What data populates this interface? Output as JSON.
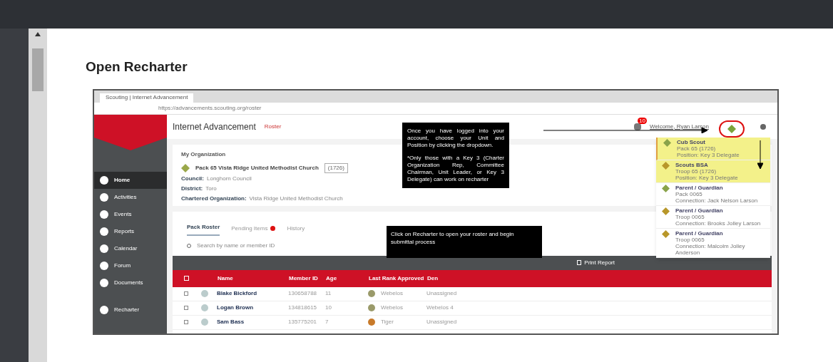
{
  "page_title": "Open Recharter",
  "browser": {
    "tab_title": "Scouting | Internet Advancement",
    "url": "https://advancements.scouting.org/roster"
  },
  "app": {
    "title": "Internet Advancement",
    "subtitle": "Roster",
    "notification_count": "10",
    "welcome": "Welcome, Ryan Larson"
  },
  "sidebar": [
    {
      "label": "Home",
      "selected": true
    },
    {
      "label": "Activities",
      "selected": false
    },
    {
      "label": "Events",
      "selected": false
    },
    {
      "label": "Reports",
      "selected": false
    },
    {
      "label": "Calendar",
      "selected": false
    },
    {
      "label": "Forum",
      "selected": false
    },
    {
      "label": "Documents",
      "selected": false
    },
    {
      "label": "Recharter",
      "selected": false
    }
  ],
  "organization": {
    "heading": "My Organization",
    "unit": "Pack 65 Vista Ridge United Methodist Church",
    "unit_id": "(1726)",
    "details": [
      {
        "label": "Council:",
        "value": "Longhorn Council"
      },
      {
        "label": "District:",
        "value": "Toro"
      },
      {
        "label": "Chartered Organization:",
        "value": "Vista Ridge United Methodist Church"
      }
    ]
  },
  "tabs": [
    {
      "label": "Pack Roster",
      "selected": true,
      "alert": false
    },
    {
      "label": "Pending Items",
      "selected": false,
      "alert": true
    },
    {
      "label": "History",
      "selected": false,
      "alert": false
    }
  ],
  "search": {
    "placeholder": "Search by name or member ID"
  },
  "toolbar": {
    "print_label": "Print Report"
  },
  "table": {
    "select_all_checked": false,
    "columns": [
      "Name",
      "Member ID",
      "Age",
      "Last Rank Approved",
      "Den"
    ],
    "rows": [
      {
        "checked": false,
        "name": "Blake Bickford",
        "member_id": "130658788",
        "age": "11",
        "rank": "Webelos",
        "color": "#9a9a6a",
        "den": "Unassigned"
      },
      {
        "checked": false,
        "name": "Logan Brown",
        "member_id": "134818615",
        "age": "10",
        "rank": "Webelos",
        "color": "#9a9a6a",
        "den": "Webelos 4"
      },
      {
        "checked": false,
        "name": "Sam Bass",
        "member_id": "135775201",
        "age": "7",
        "rank": "Tiger",
        "color": "#c87a2a",
        "den": "Unassigned"
      }
    ]
  },
  "callouts": [
    {
      "paragraphs": [
        "Once you have logged into your account, choose your Unit and Position by clicking the dropdown.",
        "*Only those with a Key 3 (Charter Organization Rep, Committee Chairman, Unit Leader, or Key 3 Delegate) can work on recharter"
      ]
    },
    {
      "paragraphs": [
        "Click on Recharter to open your roster and begin submittal process"
      ]
    }
  ],
  "position_menu": {
    "items": [
      {
        "role": "Cub Scout",
        "unit": "Pack 65 (1726)",
        "position": "Position: Key 3 Delegate",
        "highlighted": true,
        "selected": true,
        "color": "#8aa34a"
      },
      {
        "role": "Scouts BSA",
        "unit": "Troop 65 (1726)",
        "position": "Position: Key 3 Delegate",
        "highlighted": true,
        "selected": false,
        "color": "#b8972a"
      },
      {
        "role": "Parent / Guardian",
        "unit": "Pack 0065",
        "position": "Connection: Jack Nelson Larson",
        "highlighted": false,
        "selected": false,
        "color": "#8aa34a"
      },
      {
        "role": "Parent / Guardian",
        "unit": "Troop 0065",
        "position": "Connection: Brooks Jolley Larson",
        "highlighted": false,
        "selected": false,
        "color": "#b8972a"
      },
      {
        "role": "Parent / Guardian",
        "unit": "Troop 0065",
        "position": "Connection: Malcolm Jolley Anderson",
        "highlighted": false,
        "selected": false,
        "color": "#b8972a"
      }
    ]
  }
}
